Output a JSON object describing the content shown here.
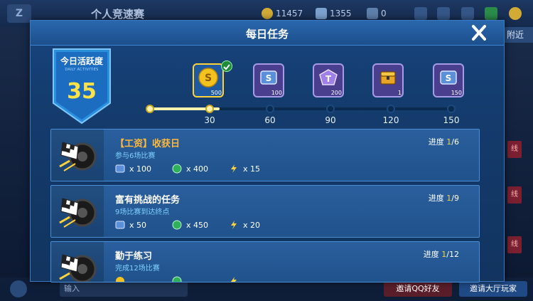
{
  "background": {
    "page_title": "个人竞速赛",
    "coins": "11457",
    "gems": "1355",
    "rank": "0",
    "nearby_label": "附近",
    "side_labels": [
      "线",
      "线",
      "线"
    ],
    "chat_placeholder": "输入",
    "invite_qq_label": "邀请QQ好友",
    "invite_hall_label": "邀请大厅玩家"
  },
  "modal": {
    "title": "每日任务",
    "activity": {
      "title": "今日活跃度",
      "subtitle": "DAILY ACTIVITIES",
      "value": "35"
    },
    "rewards": [
      {
        "amount": "500",
        "icon": "gold-coin-icon",
        "claimed": true
      },
      {
        "amount": "100",
        "icon": "s-card-icon",
        "claimed": false
      },
      {
        "amount": "200",
        "icon": "t-crystal-icon",
        "claimed": false
      },
      {
        "amount": "1",
        "icon": "treasure-chest-icon",
        "claimed": false
      },
      {
        "amount": "150",
        "icon": "s-card-icon",
        "claimed": false
      }
    ],
    "track": {
      "max": 150,
      "current": 35,
      "milestones": [
        "30",
        "60",
        "90",
        "120",
        "150"
      ]
    },
    "tasks": [
      {
        "title": "【工资】收获日",
        "highlight": true,
        "desc": "参与6场比赛",
        "progress_current": "1",
        "progress_total": "/6",
        "progress_label": "进度 ",
        "rewards": [
          "x 100",
          "x 400",
          "x 15"
        ]
      },
      {
        "title": "富有挑战的任务",
        "highlight": false,
        "desc": "9场比赛到达终点",
        "progress_current": "1",
        "progress_total": "/9",
        "progress_label": "进度 ",
        "rewards": [
          "x 50",
          "x 450",
          "x 20"
        ]
      },
      {
        "title": "勤于练习",
        "highlight": false,
        "desc": "完成12场比赛",
        "progress_current": "1",
        "progress_total": "/12",
        "progress_label": "进度 ",
        "rewards": [
          "",
          "",
          ""
        ]
      }
    ],
    "colors": {
      "accent_gold": "#ffd23a",
      "title_orange": "#ffb83a",
      "desc_blue": "#7fd0ff"
    }
  }
}
